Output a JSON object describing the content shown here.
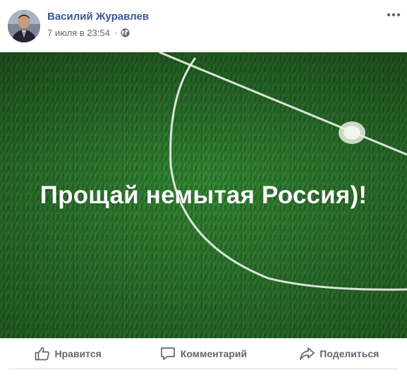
{
  "post": {
    "author": "Василий Журавлев",
    "date": "7 июля в 23:54",
    "separator": "·",
    "privacy_icon": "globe-icon",
    "more_icon": "more-options-icon",
    "image_text": "Прощай немытая Россия)!"
  },
  "actions": {
    "like": {
      "label": "Нравится",
      "icon": "thumbs-up-icon"
    },
    "comment": {
      "label": "Комментарий",
      "icon": "comment-icon"
    },
    "share": {
      "label": "Поделиться",
      "icon": "share-icon"
    }
  },
  "colors": {
    "author_link": "#385898",
    "meta_text": "#616770",
    "action_text": "#606770",
    "grass": "#2f7a2f",
    "field_line": "#e9efe6"
  }
}
